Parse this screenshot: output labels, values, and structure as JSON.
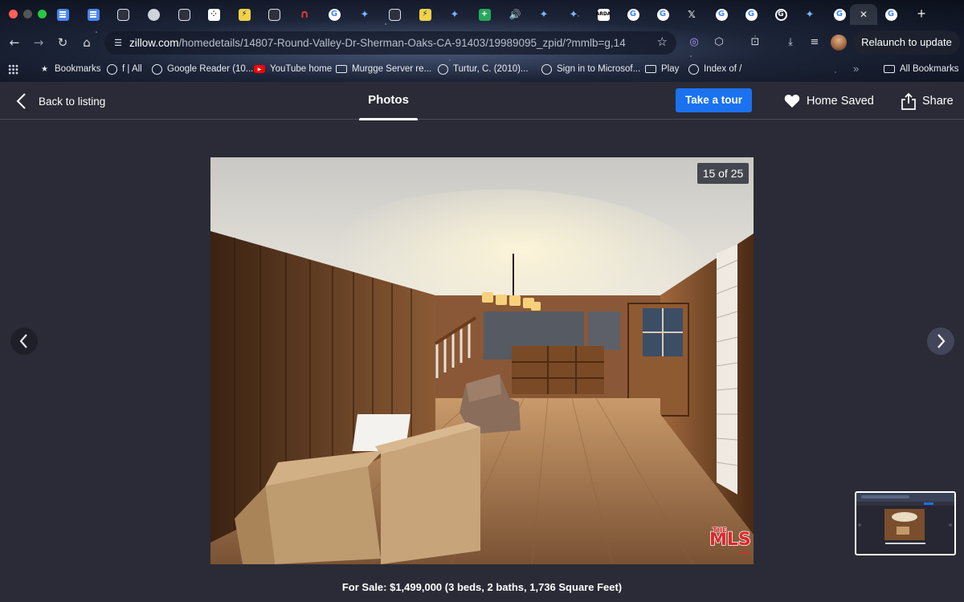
{
  "browser": {
    "url_host": "zillow.com",
    "url_path": "/homedetails/14807-Round-Valley-Dr-Sherman-Oaks-CA-91403/19989095_zpid/?mmlb=g,14",
    "relaunch_label": "Relaunch to update",
    "bookmarks": [
      {
        "label": "Bookmarks",
        "icon": "star-icon"
      },
      {
        "label": "f | All",
        "icon": "globe-icon"
      },
      {
        "label": "Google Reader (10...",
        "icon": "globe-icon"
      },
      {
        "label": "YouTube home",
        "icon": "youtube-icon"
      },
      {
        "label": "Murgge Server re...",
        "icon": "folder-icon"
      },
      {
        "label": "Turtur, C. (2010)...",
        "icon": "globe-icon"
      },
      {
        "label": "Sign in to Microsof...",
        "icon": "globe-icon"
      },
      {
        "label": "Play",
        "icon": "folder-icon"
      },
      {
        "label": "Index of /",
        "icon": "globe-icon"
      }
    ],
    "all_bookmarks_label": "All Bookmarks",
    "overflow_label": "»"
  },
  "header": {
    "back_label": "Back to listing",
    "active_tab": "Photos",
    "tour_button": "Take a tour",
    "saved_label": "Home Saved",
    "share_label": "Share"
  },
  "viewer": {
    "current_photo": "15",
    "total_photos": "25",
    "counter_text": "15 of 25",
    "caption": "For Sale: $1,499,000 (3 beds, 2 baths, 1,736 Square Feet)",
    "watermark_logo": "THE MLS.com"
  },
  "colors": {
    "accent_blue": "#1b72f0",
    "page_bg": "#2a2b36"
  }
}
